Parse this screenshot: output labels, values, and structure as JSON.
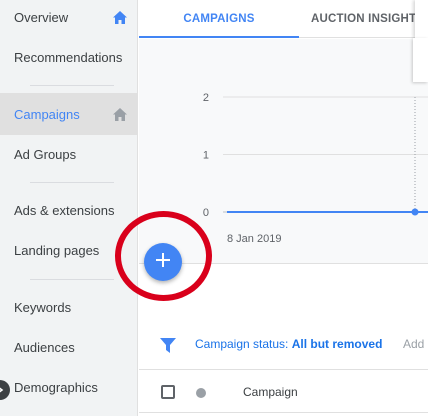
{
  "sidebar": {
    "items": [
      {
        "label": "Overview",
        "icon": "home-icon"
      },
      {
        "label": "Recommendations"
      },
      {
        "label": "Campaigns",
        "icon": "home-icon",
        "active": true
      },
      {
        "label": "Ad Groups"
      },
      {
        "label": "Ads & extensions"
      },
      {
        "label": "Landing pages"
      },
      {
        "label": "Keywords"
      },
      {
        "label": "Audiences"
      },
      {
        "label": "Demographics"
      }
    ]
  },
  "tabs": [
    {
      "label": "CAMPAIGNS",
      "active": true
    },
    {
      "label": "AUCTION INSIGHTS"
    }
  ],
  "chart_data": {
    "type": "line",
    "x": [
      "8 Jan 2019"
    ],
    "series": [
      {
        "values": [
          0,
          0
        ]
      }
    ],
    "yticks": [
      0,
      1,
      2
    ],
    "ylim": [
      0,
      2
    ],
    "xtick_label": "8 Jan 2019",
    "grid": true,
    "line_color": "#4285f4"
  },
  "fab": {
    "icon": "plus-icon",
    "color": "#4285f4"
  },
  "annotation": {
    "shape": "circle",
    "color": "#d9001b"
  },
  "filter": {
    "prefix": "Campaign status: ",
    "value": "All but removed",
    "add": "Add"
  },
  "table": {
    "columns": [
      "Campaign"
    ]
  },
  "colors": {
    "accent": "#4285f4",
    "sidebar_bg": "#f1f3f4",
    "chart_bg": "#f8f9fa"
  }
}
